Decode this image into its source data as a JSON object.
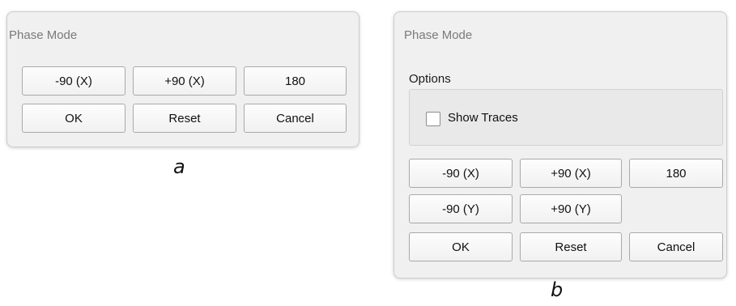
{
  "dialog_a": {
    "title": "Phase Mode",
    "row1": [
      "-90 (X)",
      "+90 (X)",
      "180"
    ],
    "row2": [
      "OK",
      "Reset",
      "Cancel"
    ],
    "caption": "a"
  },
  "dialog_b": {
    "title": "Phase Mode",
    "options_label": "Options",
    "show_traces": {
      "label": "Show Traces",
      "checked": false
    },
    "row1": [
      "-90 (X)",
      "+90 (X)",
      "180"
    ],
    "row2": [
      "-90 (Y)",
      "+90 (Y)"
    ],
    "row3": [
      "OK",
      "Reset",
      "Cancel"
    ],
    "caption": "b"
  }
}
